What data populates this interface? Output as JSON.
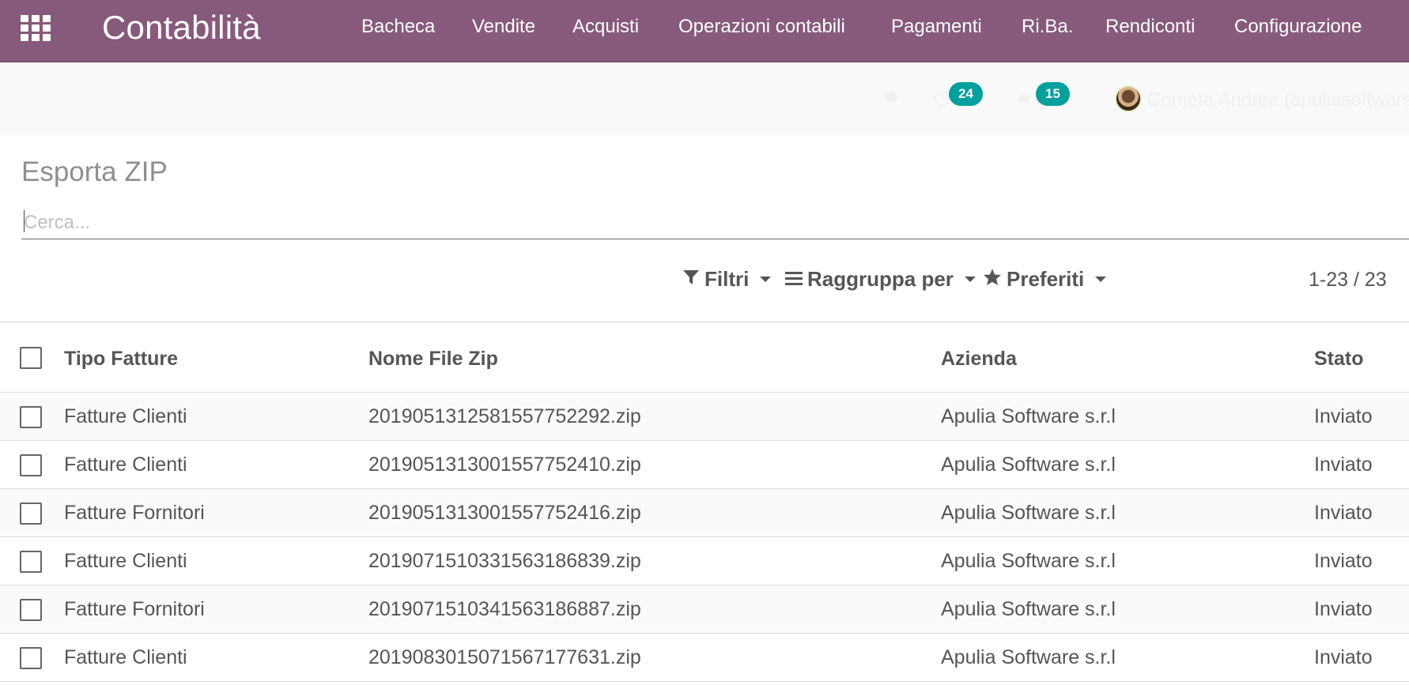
{
  "app": {
    "brand": "Contabilità",
    "menu": [
      {
        "label": "Bacheca"
      },
      {
        "label": "Vendite"
      },
      {
        "label": "Acquisti"
      },
      {
        "label": "Operazioni contabili"
      },
      {
        "label": "Pagamenti"
      },
      {
        "label": "Ri.Ba."
      },
      {
        "label": "Rendiconti"
      },
      {
        "label": "Configurazione"
      }
    ]
  },
  "systray": {
    "activity_count": "24",
    "messages_count": "15",
    "user_name": "Cometa Andrea (apuliasoftware"
  },
  "control_panel": {
    "breadcrumb": "Esporta ZIP",
    "search_placeholder": "Cerca...",
    "filters_label": "Filtri",
    "groupby_label": "Raggruppa per",
    "favorites_label": "Preferiti",
    "pager": "1-23 / 23"
  },
  "table": {
    "columns": [
      "Tipo Fatture",
      "Nome File Zip",
      "Azienda",
      "Stato"
    ],
    "rows": [
      {
        "tipo": "Fatture Clienti",
        "file": "201905131258​1557752292.zip",
        "azienda": "Apulia Software s.r.l",
        "stato": "Inviato"
      },
      {
        "tipo": "Fatture Clienti",
        "file": "20190513130015577524​10.zip",
        "azienda": "Apulia Software s.r.l",
        "stato": "Inviato"
      },
      {
        "tipo": "Fatture Fornitori",
        "file": "20190513130015577524​16.zip",
        "azienda": "Apulia Software s.r.l",
        "stato": "Inviato"
      },
      {
        "tipo": "Fatture Clienti",
        "file": "2019071510331563186839.zip",
        "azienda": "Apulia Software s.r.l",
        "stato": "Inviato"
      },
      {
        "tipo": "Fatture Fornitori",
        "file": "2019071510341563186887.zip",
        "azienda": "Apulia Software s.r.l",
        "stato": "Inviato"
      },
      {
        "tipo": "Fatture Clienti",
        "file": "2019083015071567177631.zip",
        "azienda": "Apulia Software s.r.l",
        "stato": "Inviato"
      }
    ]
  },
  "colors": {
    "navbar": "#875a7b",
    "badge": "#00a09d"
  }
}
